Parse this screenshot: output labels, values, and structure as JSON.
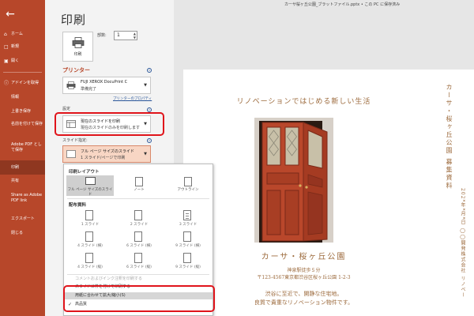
{
  "app": {
    "file_title": "カーサ桜ヶ丘公園_ブラットファイル.pptx • この PC に保存済み"
  },
  "sidebar": {
    "back_icon": "back-arrow-icon",
    "items": [
      {
        "label": "ホーム",
        "icon": "home-icon"
      },
      {
        "label": "新規",
        "icon": "new-file-icon"
      },
      {
        "label": "開く",
        "icon": "folder-open-icon"
      },
      {
        "label": "アドインを取得",
        "icon": "info-icon"
      },
      {
        "label": "情報"
      },
      {
        "label": "上書き保存"
      },
      {
        "label": "名前を付けて保存"
      },
      {
        "label": "Adobe PDF として保存"
      },
      {
        "label": "印刷",
        "active": true
      },
      {
        "label": "共有"
      },
      {
        "label": "Share as Adobe PDF link"
      },
      {
        "label": "エクスポート"
      },
      {
        "label": "閉じる"
      }
    ]
  },
  "print": {
    "title": "印刷",
    "button_label": "印刷",
    "copies_label": "部数:",
    "copies_value": "1"
  },
  "printer": {
    "heading": "プリンター",
    "name": "FUJI XEROX DocuPrint C",
    "status": "準備完了",
    "properties_link": "プリンターのプロパティ"
  },
  "settings": {
    "heading": "設定",
    "range_line1": "現在のスライドを印刷",
    "range_line2": "現在のスライドのみを印刷します",
    "slides_label": "スライド指定:",
    "layout_line1": "フル ページ サイズのスライド",
    "layout_line2": "1 スライド/ページで印刷"
  },
  "flyout": {
    "print_layout_heading": "印刷レイアウト",
    "layout_options": [
      "フル ページ サイズのスライド",
      "ノート",
      "アウトライン"
    ],
    "handouts_heading": "配布資料",
    "handout_options": [
      {
        "label": "1 スライド",
        "lines": 0
      },
      {
        "label": "2 スライド",
        "lines": 0
      },
      {
        "label": "3 スライド",
        "lines": 3
      },
      {
        "label": "4 スライド (横)",
        "lines": 0
      },
      {
        "label": "6 スライド (横)",
        "lines": 0
      },
      {
        "label": "9 スライド (横)",
        "lines": 0
      },
      {
        "label": "4 スライド (縦)",
        "lines": 0
      },
      {
        "label": "6 スライド (縦)",
        "lines": 0
      },
      {
        "label": "9 スライド (縦)",
        "lines": 0
      }
    ],
    "item_comments": "コメントおよびインク注釈を印刷する",
    "item_frame": "スライドに枠を付けて印刷する",
    "item_fit": "用紙に合わせて拡大/縮小(S)",
    "item_hq": "高品質"
  },
  "preview": {
    "headline": "リノベーションではじめる新しい生活",
    "property_name": "カーサ・桜ヶ丘公園",
    "address1": "神泉駅徒歩５分",
    "address2": "〒123-4567東京都渋谷区桜ヶ丘公園 1-2-3",
    "tagline1": "渋谷に至近で、開静な住宅地。",
    "tagline2": "良質で貴重なリノベーション物件です。",
    "vertical_title": "カーサ・桜ヶ丘公園 募集資料",
    "vertical_sub": "202*年*月*日 ◯◯開発株式会社 リノベー"
  },
  "colors": {
    "accent": "#b7472a",
    "callout": "#e0141b",
    "preview_text": "#9c6a3c",
    "door": "#b9472b"
  }
}
